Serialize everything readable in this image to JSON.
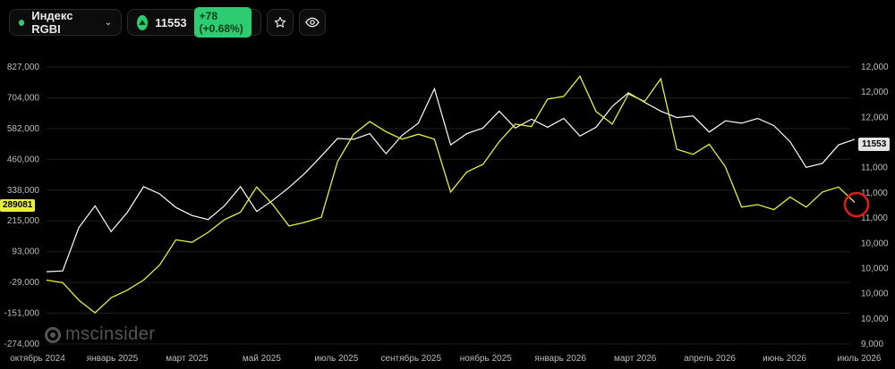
{
  "header": {
    "symbol": "Индекс RGBI",
    "price": "11553",
    "change": "+78 (+0.68%)",
    "chevron_icon": "chevron-down-icon",
    "star_icon": "star-icon",
    "eye_icon": "eye-icon"
  },
  "watermark": "mscinsider",
  "colors": {
    "white_series": "#ffffff",
    "yellow_series": "#e6f03a",
    "up": "#2ecc71",
    "marker": "#e01b1b"
  },
  "chart_data": {
    "type": "line",
    "x_labels": [
      "октябрь 2024",
      "январь 2025",
      "март 2025",
      "май 2025",
      "июль 2025",
      "сентябрь 2025",
      "ноябрь 2025",
      "январь 2026",
      "март 2026",
      "апрель 2026",
      "июнь 2026",
      "июль 2026"
    ],
    "left_axis_ticks": [
      "827,000",
      "704,000",
      "582,000",
      "460,000",
      "338,000",
      "215,000",
      "93,000",
      "-29,000",
      "-151,000",
      "-274,000"
    ],
    "right_axis_ticks": [
      "12,000",
      "12,000",
      "12,000",
      "12,000",
      "11,000",
      "11,000",
      "11,000",
      "10,000",
      "10,000",
      "10,000",
      "10,000",
      "9,000"
    ],
    "left_current_label": "289081",
    "right_current_label": "11553",
    "grid": "horizontal",
    "series": [
      {
        "axis": "right",
        "values": [
          9900,
          9910,
          10450,
          10720,
          10400,
          10640,
          10960,
          10870,
          10700,
          10600,
          10550,
          10720,
          10960,
          10650,
          10790,
          10950,
          11130,
          11340,
          11560,
          11550,
          11620,
          11370,
          11600,
          11750,
          12180,
          11480,
          11620,
          11690,
          11900,
          11690,
          11800,
          11700,
          11810,
          11590,
          11700,
          11960,
          12130,
          12010,
          11900,
          11820,
          11840,
          11640,
          11780,
          11750,
          11810,
          11720,
          11520,
          11200,
          11250,
          11480,
          11550
        ]
      },
      {
        "axis": "left",
        "values": [
          -20000,
          -30000,
          -100000,
          -150000,
          -90000,
          -60000,
          -20000,
          40000,
          140000,
          130000,
          170000,
          220000,
          250000,
          350000,
          280000,
          195000,
          210000,
          230000,
          450000,
          560000,
          610000,
          570000,
          540000,
          560000,
          540000,
          330000,
          410000,
          440000,
          530000,
          600000,
          590000,
          700000,
          710000,
          790000,
          650000,
          600000,
          720000,
          690000,
          780000,
          500000,
          480000,
          520000,
          430000,
          270000,
          280000,
          260000,
          310000,
          270000,
          330000,
          350000,
          289081
        ]
      }
    ]
  }
}
